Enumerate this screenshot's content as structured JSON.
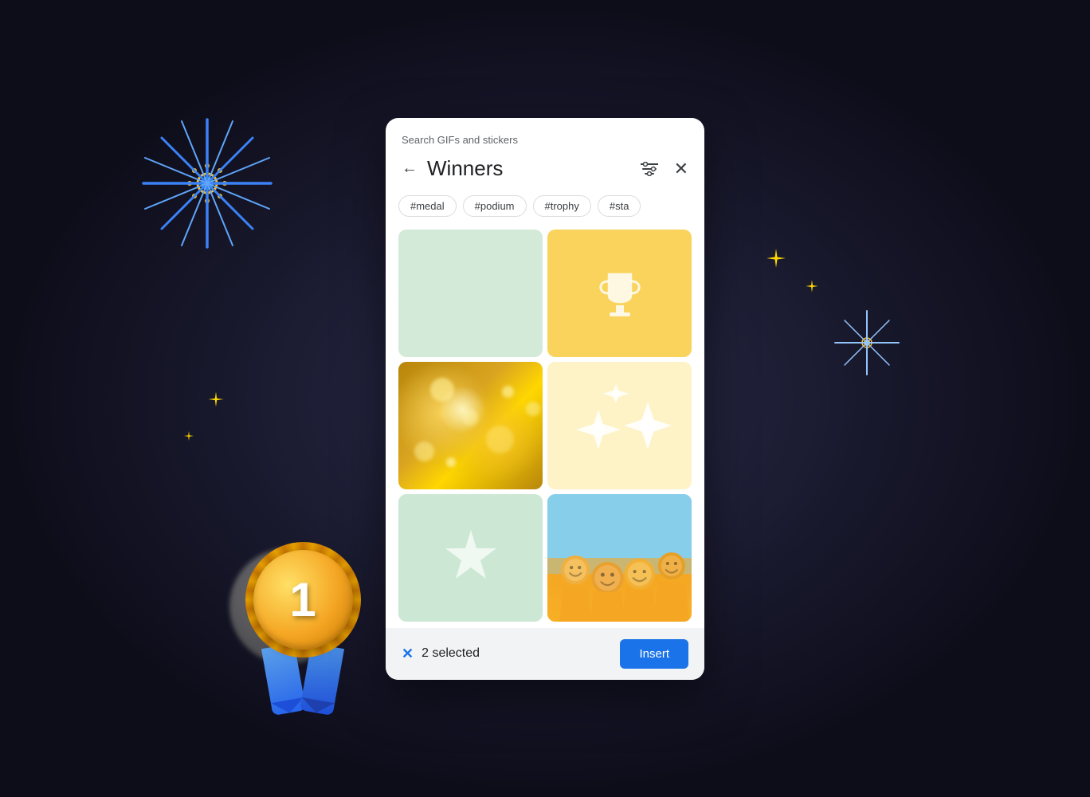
{
  "background": {
    "color": "#1a1a2e"
  },
  "header_label": "Search GIFs and stickers",
  "dialog": {
    "title": "Winners",
    "tags": [
      "#medal",
      "#podium",
      "#trophy",
      "#sta"
    ],
    "grid": [
      {
        "id": "cell1",
        "type": "mint-blank",
        "label": "Mint blank GIF"
      },
      {
        "id": "cell2",
        "type": "yellow-trophy",
        "label": "Trophy GIF"
      },
      {
        "id": "cell3",
        "type": "gold-bokeh",
        "label": "Gold bokeh GIF"
      },
      {
        "id": "cell4",
        "type": "sparkle-diamonds",
        "label": "Sparkle diamonds GIF"
      },
      {
        "id": "cell5",
        "type": "mint-star",
        "label": "Mint star GIF"
      },
      {
        "id": "cell6",
        "type": "team-photo",
        "label": "Team celebration photo"
      }
    ],
    "footer": {
      "selected_count": "2 selected",
      "insert_label": "Insert"
    }
  },
  "decorations": {
    "medal_number": "1",
    "sparkles": [
      "✦",
      "✦",
      "✦",
      "✦"
    ]
  }
}
